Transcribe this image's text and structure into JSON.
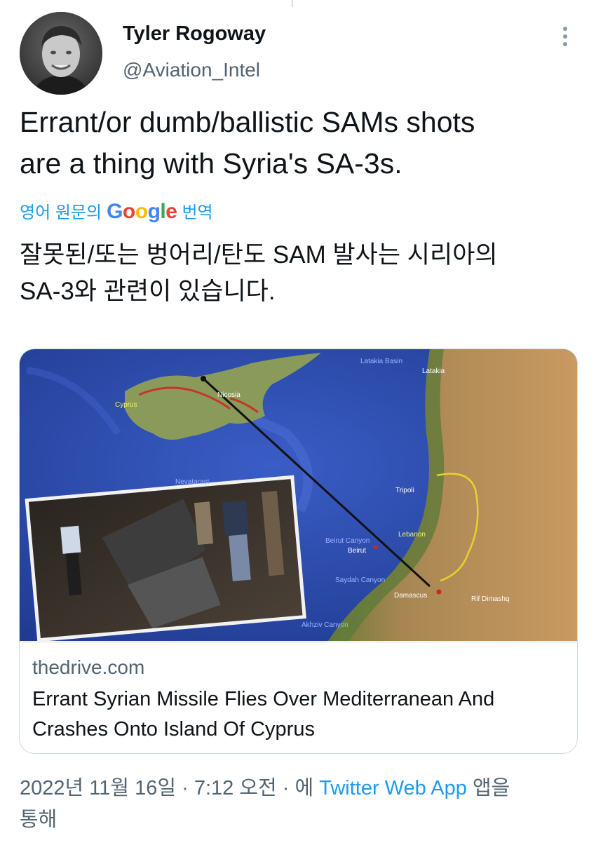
{
  "author": {
    "name": "Tyler Rogoway",
    "handle": "@Aviation_Intel"
  },
  "tweet": {
    "text_line1": "Errant/or dumb/ballistic SAMs shots",
    "text_line2": "are a thing with Syria's SA-3s."
  },
  "translate": {
    "prefix": "영어 원문의",
    "brand": "Google",
    "suffix": "번역"
  },
  "translation": {
    "line1": "잘못된/또는 벙어리/탄도 SAM 발사는 시리아의",
    "line2": "SA-3와 관련이 있습니다."
  },
  "card": {
    "domain": "thedrive.com",
    "title_line1": "Errant Syrian Missile Flies Over Mediterranean And",
    "title_line2": "Crashes Onto Island Of Cyprus",
    "map_labels": {
      "cyprus": "Cyprus",
      "nicosia": "Nicosia",
      "latakia_basin": "Latakia Basin",
      "latakia": "Latakia",
      "tripoli": "Tripoli",
      "lebanon": "Lebanon",
      "beirut_canyon": "Beirut Canyon",
      "beirut": "Beirut",
      "saydah_canyon": "Saydah Canyon",
      "damascus": "Damascus",
      "rif_dimashq": "Rif Dimashq",
      "akhziv": "Akhziv Canyon",
      "inset_top": "Nevatarast"
    }
  },
  "meta": {
    "date": "2022년 11월 16일",
    "sep1": "·",
    "time": "7:12 오전",
    "sep2": "·",
    "via": "에",
    "app": "Twitter Web App",
    "suffix": "앱을",
    "suffix2": "통해"
  },
  "colors": {
    "link": "#1d9bf0",
    "secondary_text": "#536471",
    "sea": "#2f4fb0",
    "land": "#b58a5a"
  }
}
